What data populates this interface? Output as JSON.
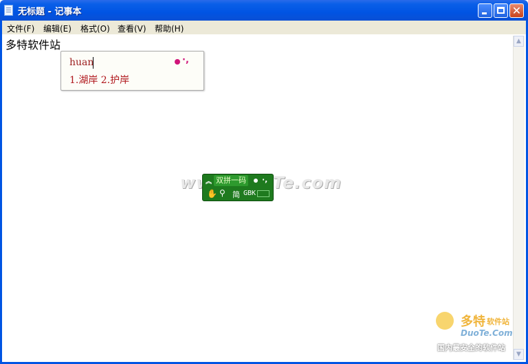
{
  "window": {
    "title": "无标题 - 记事本",
    "close_glyph": "✕"
  },
  "menu": {
    "items": [
      "文件(F)",
      "编辑(E)",
      "格式(O)",
      "查看(V)",
      "帮助(H)"
    ]
  },
  "document": {
    "text": "多特软件站"
  },
  "ime": {
    "composition": "huan",
    "candidates": "1.湖岸 2.护岸",
    "status": {
      "mode_label": "双拼一码",
      "charset_short": "简",
      "charset": "GBK"
    }
  },
  "watermark": {
    "text": "www.DuoTe.com"
  },
  "logo": {
    "name_cn": "多特",
    "name_cn_suffix": "软件站",
    "name_en": "DuoTe.Com",
    "slogan": "国内最安全的软件站"
  },
  "colors": {
    "titlebar": "#0054e3",
    "ime_text": "#b0161b",
    "ime_status_bg": "#1e7a1e"
  }
}
